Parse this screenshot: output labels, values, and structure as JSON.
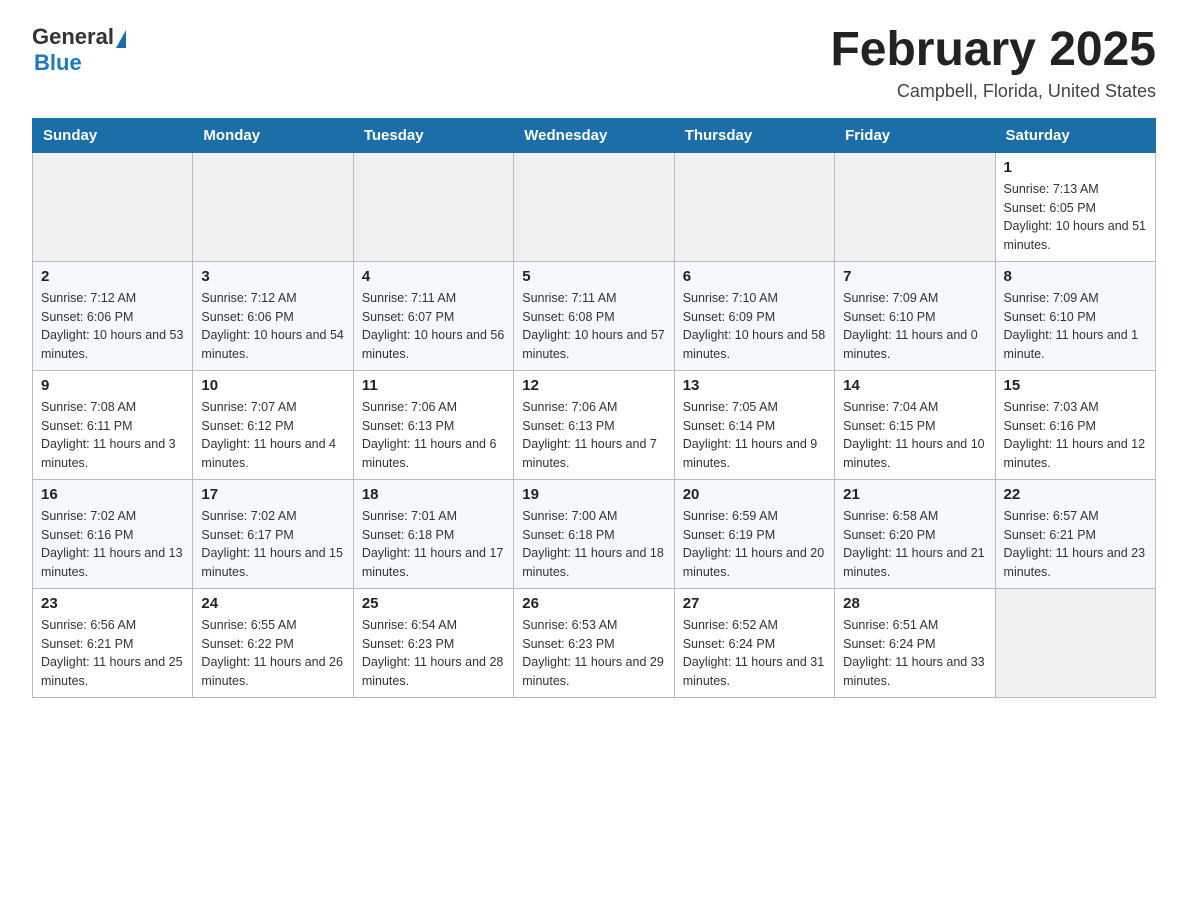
{
  "header": {
    "logo_general": "General",
    "logo_blue": "Blue",
    "month_title": "February 2025",
    "location": "Campbell, Florida, United States"
  },
  "weekdays": [
    "Sunday",
    "Monday",
    "Tuesday",
    "Wednesday",
    "Thursday",
    "Friday",
    "Saturday"
  ],
  "weeks": [
    [
      {
        "day": "",
        "sunrise": "",
        "sunset": "",
        "daylight": ""
      },
      {
        "day": "",
        "sunrise": "",
        "sunset": "",
        "daylight": ""
      },
      {
        "day": "",
        "sunrise": "",
        "sunset": "",
        "daylight": ""
      },
      {
        "day": "",
        "sunrise": "",
        "sunset": "",
        "daylight": ""
      },
      {
        "day": "",
        "sunrise": "",
        "sunset": "",
        "daylight": ""
      },
      {
        "day": "",
        "sunrise": "",
        "sunset": "",
        "daylight": ""
      },
      {
        "day": "1",
        "sunrise": "Sunrise: 7:13 AM",
        "sunset": "Sunset: 6:05 PM",
        "daylight": "Daylight: 10 hours and 51 minutes."
      }
    ],
    [
      {
        "day": "2",
        "sunrise": "Sunrise: 7:12 AM",
        "sunset": "Sunset: 6:06 PM",
        "daylight": "Daylight: 10 hours and 53 minutes."
      },
      {
        "day": "3",
        "sunrise": "Sunrise: 7:12 AM",
        "sunset": "Sunset: 6:06 PM",
        "daylight": "Daylight: 10 hours and 54 minutes."
      },
      {
        "day": "4",
        "sunrise": "Sunrise: 7:11 AM",
        "sunset": "Sunset: 6:07 PM",
        "daylight": "Daylight: 10 hours and 56 minutes."
      },
      {
        "day": "5",
        "sunrise": "Sunrise: 7:11 AM",
        "sunset": "Sunset: 6:08 PM",
        "daylight": "Daylight: 10 hours and 57 minutes."
      },
      {
        "day": "6",
        "sunrise": "Sunrise: 7:10 AM",
        "sunset": "Sunset: 6:09 PM",
        "daylight": "Daylight: 10 hours and 58 minutes."
      },
      {
        "day": "7",
        "sunrise": "Sunrise: 7:09 AM",
        "sunset": "Sunset: 6:10 PM",
        "daylight": "Daylight: 11 hours and 0 minutes."
      },
      {
        "day": "8",
        "sunrise": "Sunrise: 7:09 AM",
        "sunset": "Sunset: 6:10 PM",
        "daylight": "Daylight: 11 hours and 1 minute."
      }
    ],
    [
      {
        "day": "9",
        "sunrise": "Sunrise: 7:08 AM",
        "sunset": "Sunset: 6:11 PM",
        "daylight": "Daylight: 11 hours and 3 minutes."
      },
      {
        "day": "10",
        "sunrise": "Sunrise: 7:07 AM",
        "sunset": "Sunset: 6:12 PM",
        "daylight": "Daylight: 11 hours and 4 minutes."
      },
      {
        "day": "11",
        "sunrise": "Sunrise: 7:06 AM",
        "sunset": "Sunset: 6:13 PM",
        "daylight": "Daylight: 11 hours and 6 minutes."
      },
      {
        "day": "12",
        "sunrise": "Sunrise: 7:06 AM",
        "sunset": "Sunset: 6:13 PM",
        "daylight": "Daylight: 11 hours and 7 minutes."
      },
      {
        "day": "13",
        "sunrise": "Sunrise: 7:05 AM",
        "sunset": "Sunset: 6:14 PM",
        "daylight": "Daylight: 11 hours and 9 minutes."
      },
      {
        "day": "14",
        "sunrise": "Sunrise: 7:04 AM",
        "sunset": "Sunset: 6:15 PM",
        "daylight": "Daylight: 11 hours and 10 minutes."
      },
      {
        "day": "15",
        "sunrise": "Sunrise: 7:03 AM",
        "sunset": "Sunset: 6:16 PM",
        "daylight": "Daylight: 11 hours and 12 minutes."
      }
    ],
    [
      {
        "day": "16",
        "sunrise": "Sunrise: 7:02 AM",
        "sunset": "Sunset: 6:16 PM",
        "daylight": "Daylight: 11 hours and 13 minutes."
      },
      {
        "day": "17",
        "sunrise": "Sunrise: 7:02 AM",
        "sunset": "Sunset: 6:17 PM",
        "daylight": "Daylight: 11 hours and 15 minutes."
      },
      {
        "day": "18",
        "sunrise": "Sunrise: 7:01 AM",
        "sunset": "Sunset: 6:18 PM",
        "daylight": "Daylight: 11 hours and 17 minutes."
      },
      {
        "day": "19",
        "sunrise": "Sunrise: 7:00 AM",
        "sunset": "Sunset: 6:18 PM",
        "daylight": "Daylight: 11 hours and 18 minutes."
      },
      {
        "day": "20",
        "sunrise": "Sunrise: 6:59 AM",
        "sunset": "Sunset: 6:19 PM",
        "daylight": "Daylight: 11 hours and 20 minutes."
      },
      {
        "day": "21",
        "sunrise": "Sunrise: 6:58 AM",
        "sunset": "Sunset: 6:20 PM",
        "daylight": "Daylight: 11 hours and 21 minutes."
      },
      {
        "day": "22",
        "sunrise": "Sunrise: 6:57 AM",
        "sunset": "Sunset: 6:21 PM",
        "daylight": "Daylight: 11 hours and 23 minutes."
      }
    ],
    [
      {
        "day": "23",
        "sunrise": "Sunrise: 6:56 AM",
        "sunset": "Sunset: 6:21 PM",
        "daylight": "Daylight: 11 hours and 25 minutes."
      },
      {
        "day": "24",
        "sunrise": "Sunrise: 6:55 AM",
        "sunset": "Sunset: 6:22 PM",
        "daylight": "Daylight: 11 hours and 26 minutes."
      },
      {
        "day": "25",
        "sunrise": "Sunrise: 6:54 AM",
        "sunset": "Sunset: 6:23 PM",
        "daylight": "Daylight: 11 hours and 28 minutes."
      },
      {
        "day": "26",
        "sunrise": "Sunrise: 6:53 AM",
        "sunset": "Sunset: 6:23 PM",
        "daylight": "Daylight: 11 hours and 29 minutes."
      },
      {
        "day": "27",
        "sunrise": "Sunrise: 6:52 AM",
        "sunset": "Sunset: 6:24 PM",
        "daylight": "Daylight: 11 hours and 31 minutes."
      },
      {
        "day": "28",
        "sunrise": "Sunrise: 6:51 AM",
        "sunset": "Sunset: 6:24 PM",
        "daylight": "Daylight: 11 hours and 33 minutes."
      },
      {
        "day": "",
        "sunrise": "",
        "sunset": "",
        "daylight": ""
      }
    ]
  ]
}
